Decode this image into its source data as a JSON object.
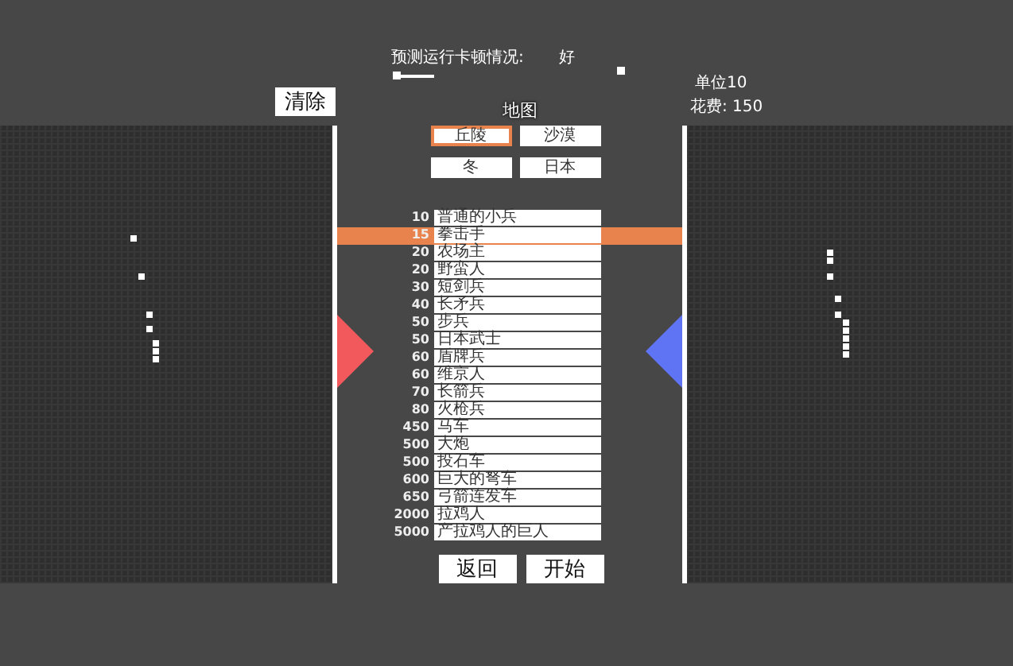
{
  "lag": {
    "label": "预测运行卡顿情况:",
    "value": "好",
    "level": 0.18
  },
  "clear_button": "清除",
  "unit_info": {
    "units": "单位10",
    "cost": "花费: 150"
  },
  "map": {
    "title": "地图",
    "options": [
      {
        "label": "丘陵",
        "selected": true
      },
      {
        "label": "沙漠",
        "selected": false
      },
      {
        "label": "冬",
        "selected": false
      },
      {
        "label": "日本",
        "selected": false
      }
    ]
  },
  "units": [
    {
      "cost": "10",
      "name": "普通的小兵",
      "selected": false
    },
    {
      "cost": "15",
      "name": "拳击手",
      "selected": true
    },
    {
      "cost": "20",
      "name": "农场主",
      "selected": false
    },
    {
      "cost": "20",
      "name": "野蛮人",
      "selected": false
    },
    {
      "cost": "30",
      "name": "短剑兵",
      "selected": false
    },
    {
      "cost": "40",
      "name": "长矛兵",
      "selected": false
    },
    {
      "cost": "50",
      "name": "步兵",
      "selected": false
    },
    {
      "cost": "50",
      "name": "日本武士",
      "selected": false
    },
    {
      "cost": "60",
      "name": "盾牌兵",
      "selected": false
    },
    {
      "cost": "60",
      "name": "维京人",
      "selected": false
    },
    {
      "cost": "70",
      "name": "长箭兵",
      "selected": false
    },
    {
      "cost": "80",
      "name": "火枪兵",
      "selected": false
    },
    {
      "cost": "450",
      "name": "马车",
      "selected": false
    },
    {
      "cost": "500",
      "name": "大炮",
      "selected": false
    },
    {
      "cost": "500",
      "name": "投石车",
      "selected": false
    },
    {
      "cost": "600",
      "name": "巨大的弩车",
      "selected": false
    },
    {
      "cost": "650",
      "name": "弓箭连发车",
      "selected": false
    },
    {
      "cost": "2000",
      "name": "拉鸡人",
      "selected": false
    },
    {
      "cost": "5000",
      "name": "产拉鸡人的巨人",
      "selected": false
    }
  ],
  "buttons": [
    "返回",
    "开始"
  ]
}
